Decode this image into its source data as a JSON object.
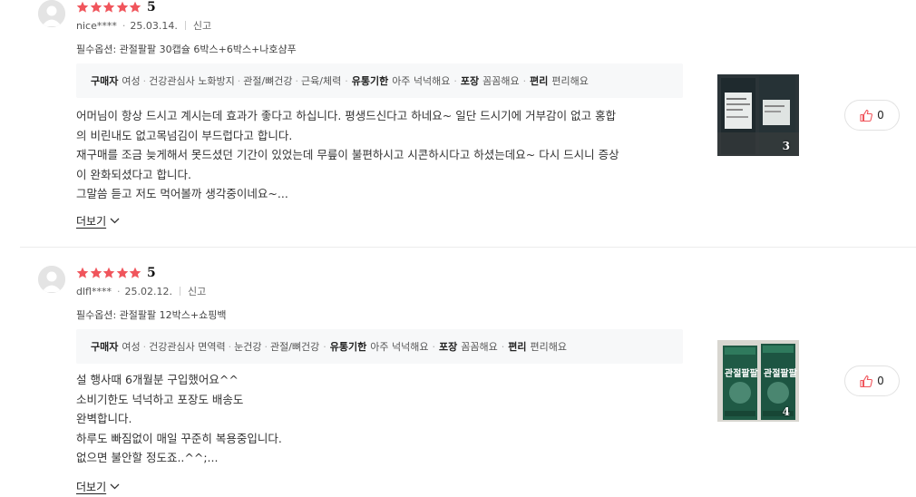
{
  "colors": {
    "star": "#f0555c",
    "like_icon": "#f0555c",
    "tag_bg": "#f7f8f9"
  },
  "reviews": [
    {
      "rating": "5",
      "stars": 5,
      "username": "nice****",
      "date": "25.03.14.",
      "report_label": "신고",
      "option": "필수옵션: 관절팔팔 30캡슐 6박스+6박스+나호샴푸",
      "tags": {
        "buyer_label": "구매자",
        "buyer_values": [
          "여성",
          "건강관심사 노화방지",
          "관절/뼈건강",
          "근육/체력"
        ],
        "items": [
          {
            "label": "유통기한",
            "value": "아주 넉넉해요"
          },
          {
            "label": "포장",
            "value": "꼼꼼해요"
          },
          {
            "label": "편리",
            "value": "편리해요"
          }
        ]
      },
      "body": "어머님이 항상 드시고 계시는데 효과가 좋다고 하십니다. 평생드신다고 하네요~ 일단 드시기에 거부감이 없고 홍합\n의 비린내도 없고목넘김이 부드럽다고 합니다.\n 재구매를 조금 늦게해서 못드셨던 기간이 있었는데 무릎이 불편하시고 시콘하시다고 하셨는데요~ 다시 드시니 증상\n이 완화되셨다고 합니다.\n그말씀 듣고 저도 먹어볼까 생각중이네요~...",
      "more_label": "더보기",
      "photo_count": "3",
      "likes": "0",
      "icons": {
        "avatar": "user-avatar-icon",
        "like": "thumbs-up-icon",
        "more": "chevron-down-icon"
      }
    },
    {
      "rating": "5",
      "stars": 5,
      "username": "dlfl****",
      "date": "25.02.12.",
      "report_label": "신고",
      "option": "필수옵션: 관절팔팔 12박스+쇼핑백",
      "tags": {
        "buyer_label": "구매자",
        "buyer_values": [
          "여성",
          "건강관심사 면역력",
          "눈건강",
          "관절/뼈건강"
        ],
        "items": [
          {
            "label": "유통기한",
            "value": "아주 넉넉해요"
          },
          {
            "label": "포장",
            "value": "꼼꼼해요"
          },
          {
            "label": "편리",
            "value": "편리해요"
          }
        ]
      },
      "body": "설 행사때 6개월분 구입했어요^^\n소비기한도 넉넉하고 포장도 배송도\n완벽합니다.\n하루도 빠짐없이 매일 꾸준히 복용중입니다.\n없으면 불안할 정도죠..^^;...",
      "more_label": "더보기",
      "photo_count": "4",
      "photo_label": "관절팔팔",
      "likes": "0",
      "icons": {
        "avatar": "user-avatar-icon",
        "like": "thumbs-up-icon",
        "more": "chevron-down-icon"
      }
    }
  ]
}
